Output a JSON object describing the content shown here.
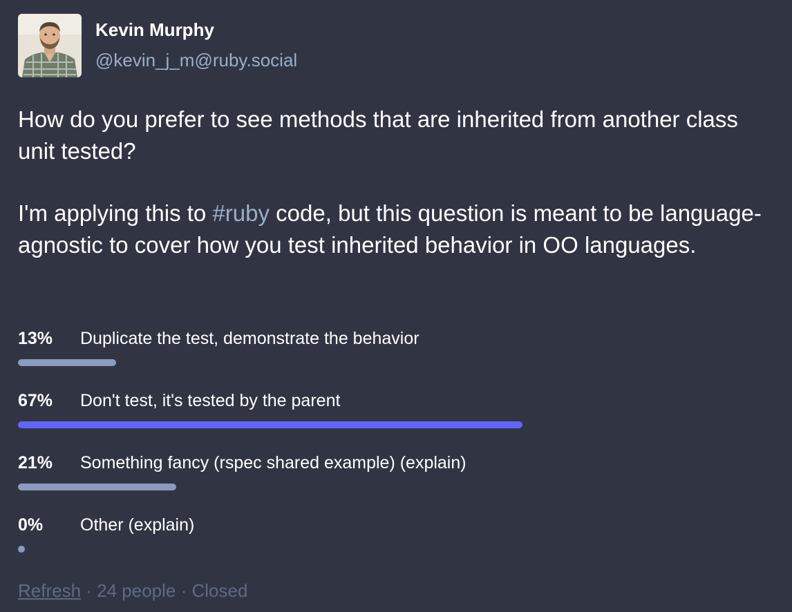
{
  "author": {
    "display_name": "Kevin Murphy",
    "handle": "@kevin_j_m@ruby.social"
  },
  "post": {
    "paragraph1": "How do you prefer to see methods that are inherited from another class unit tested?",
    "p2_before": "I'm applying this to ",
    "p2_hashtag": "#ruby",
    "p2_after": " code, but this question is meant to be language-agnostic to cover how you test inherited behavior in OO languages."
  },
  "poll": {
    "options": [
      {
        "percent": "13%",
        "fraction": 0.13,
        "label": "Duplicate the test, demonstrate the behavior",
        "leading": false
      },
      {
        "percent": "67%",
        "fraction": 0.67,
        "label": "Don't test, it's tested by the parent",
        "leading": true
      },
      {
        "percent": "21%",
        "fraction": 0.21,
        "label": "Something fancy (rspec shared example) (explain)",
        "leading": false
      },
      {
        "percent": "0%",
        "fraction": 0.0,
        "label": "Other (explain)",
        "leading": false
      }
    ],
    "footer": {
      "refresh": "Refresh",
      "separator1": " · ",
      "voters": "24 people",
      "separator2": " · ",
      "status": "Closed"
    }
  },
  "colors": {
    "background": "#313543",
    "secondary_text": "#9baec8",
    "leading_bar": "#6364ff",
    "default_bar": "#8a9bbd",
    "footer_text": "#606984"
  }
}
